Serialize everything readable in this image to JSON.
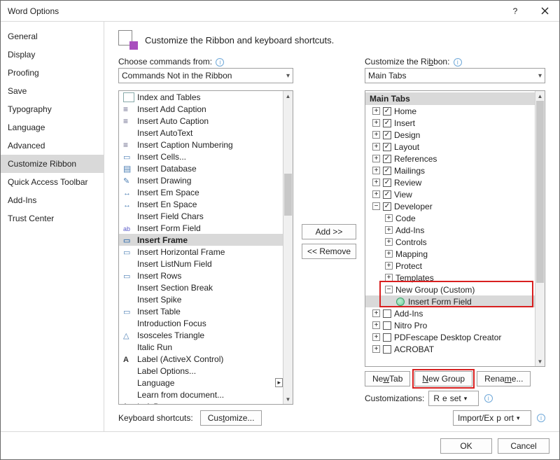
{
  "window": {
    "title": "Word Options"
  },
  "sidebar": {
    "items": [
      "General",
      "Display",
      "Proofing",
      "Save",
      "Typography",
      "Language",
      "Advanced",
      "Customize Ribbon",
      "Quick Access Toolbar",
      "Add-Ins",
      "Trust Center"
    ],
    "selected_index": 7
  },
  "header": {
    "text": "Customize the Ribbon and keyboard shortcuts."
  },
  "left": {
    "label_pre": "C",
    "label_rest": "hoose commands from:",
    "select_value": "Commands Not in the Ribbon",
    "items": [
      {
        "icon": "square",
        "label": "Index and Tables"
      },
      {
        "icon": "lines",
        "label": "Insert Add Caption"
      },
      {
        "icon": "lines",
        "label": "Insert Auto Caption"
      },
      {
        "icon": "blank",
        "label": "Insert AutoText"
      },
      {
        "icon": "lines",
        "label": "Insert Caption Numbering"
      },
      {
        "icon": "box",
        "label": "Insert Cells..."
      },
      {
        "icon": "idb",
        "label": "Insert Database"
      },
      {
        "icon": "draw",
        "label": "Insert Drawing"
      },
      {
        "icon": "arrow",
        "label": "Insert Em Space"
      },
      {
        "icon": "arrow",
        "label": "Insert En Space"
      },
      {
        "icon": "blank",
        "label": "Insert Field Chars"
      },
      {
        "icon": "ab",
        "label": "Insert Form Field"
      },
      {
        "icon": "box",
        "label": "Insert Frame",
        "selected": true
      },
      {
        "icon": "box",
        "label": "Insert Horizontal Frame"
      },
      {
        "icon": "blank",
        "label": "Insert ListNum Field"
      },
      {
        "icon": "box",
        "label": "Insert Rows"
      },
      {
        "icon": "blank",
        "label": "Insert Section Break"
      },
      {
        "icon": "blank",
        "label": "Insert Spike"
      },
      {
        "icon": "box",
        "label": "Insert Table"
      },
      {
        "icon": "blank",
        "label": "Introduction Focus"
      },
      {
        "icon": "triangle",
        "label": "Isosceles Triangle"
      },
      {
        "icon": "blank",
        "label": "Italic Run"
      },
      {
        "icon": "letterA",
        "label": "Label (ActiveX Control)"
      },
      {
        "icon": "blank",
        "label": "Label Options..."
      },
      {
        "icon": "blank",
        "label": "Language",
        "has_dropdown": true
      },
      {
        "icon": "blank",
        "label": "Learn from document..."
      },
      {
        "icon": "brace",
        "label": "Left Brace"
      }
    ]
  },
  "mid": {
    "add": "Add >>",
    "remove": "<< Remove"
  },
  "right": {
    "label_pre": "Customize the Ri",
    "label_u": "b",
    "label_post": "bon:",
    "select_value": "Main Tabs",
    "tree_header": "Main Tabs",
    "nodes": [
      {
        "level": 1,
        "exp": "+",
        "chk": true,
        "label": "Home"
      },
      {
        "level": 1,
        "exp": "+",
        "chk": true,
        "label": "Insert"
      },
      {
        "level": 1,
        "exp": "+",
        "chk": true,
        "label": "Design"
      },
      {
        "level": 1,
        "exp": "+",
        "chk": true,
        "label": "Layout"
      },
      {
        "level": 1,
        "exp": "+",
        "chk": true,
        "label": "References"
      },
      {
        "level": 1,
        "exp": "+",
        "chk": true,
        "label": "Mailings"
      },
      {
        "level": 1,
        "exp": "+",
        "chk": true,
        "label": "Review"
      },
      {
        "level": 1,
        "exp": "+",
        "chk": true,
        "label": "View"
      },
      {
        "level": 1,
        "exp": "−",
        "chk": true,
        "label": "Developer"
      },
      {
        "level": 2,
        "exp": "+",
        "label": "Code"
      },
      {
        "level": 2,
        "exp": "+",
        "label": "Add-Ins"
      },
      {
        "level": 2,
        "exp": "+",
        "label": "Controls"
      },
      {
        "level": 2,
        "exp": "+",
        "label": "Mapping"
      },
      {
        "level": 2,
        "exp": "+",
        "label": "Protect"
      },
      {
        "level": 2,
        "exp": "+",
        "label": "Templates"
      },
      {
        "level": 2,
        "exp": "−",
        "label": "New Group (Custom)",
        "highlighted_group": true
      },
      {
        "level": 3,
        "circle": true,
        "label": "Insert Form Field",
        "selected": true
      },
      {
        "level": 1,
        "exp": "+",
        "chk": false,
        "label": "Add-Ins"
      },
      {
        "level": 1,
        "exp": "+",
        "chk": false,
        "label": "Nitro Pro"
      },
      {
        "level": 1,
        "exp": "+",
        "chk": false,
        "label": "PDFescape Desktop Creator"
      },
      {
        "level": 1,
        "exp": "+",
        "chk": false,
        "label": "ACROBAT"
      }
    ],
    "buttons": {
      "new_tab_pre": "Ne",
      "new_tab_u": "w",
      "new_tab_post": " Tab",
      "new_group_pre": "",
      "new_group_u": "N",
      "new_group_post": "ew Group",
      "rename_pre": "Rena",
      "rename_u": "m",
      "rename_post": "e..."
    },
    "customizations_label": "Customizations:",
    "reset_pre": "R",
    "reset_u": "e",
    "reset_post": "set",
    "impexp_pre": "Import/Ex",
    "impexp_u": "p",
    "impexp_post": "ort"
  },
  "keyboard": {
    "label": "Keyboard shortcuts:",
    "button_pre": "Cus",
    "button_u": "t",
    "button_post": "omize..."
  },
  "footer": {
    "ok": "OK",
    "cancel": "Cancel"
  }
}
